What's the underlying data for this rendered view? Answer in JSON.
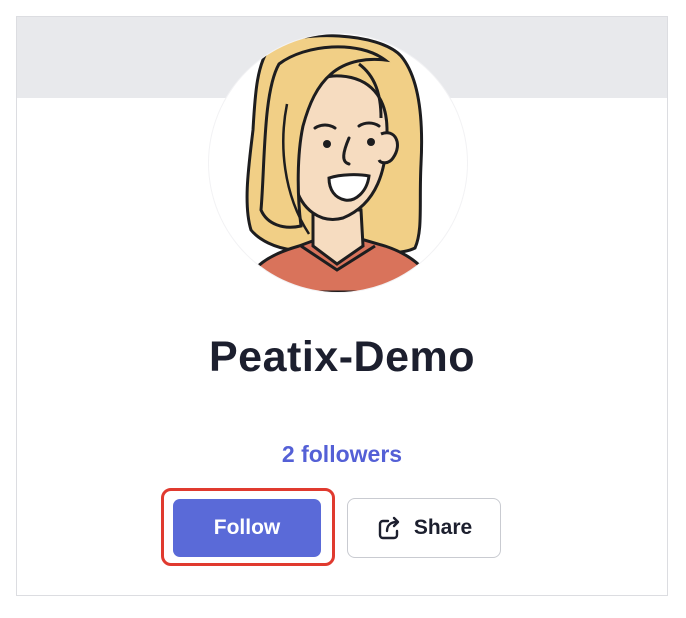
{
  "profile": {
    "name": "Peatix-Demo",
    "followers_text": "2 followers"
  },
  "actions": {
    "follow_label": "Follow",
    "share_label": "Share"
  },
  "icons": {
    "share": "share-icon",
    "avatar": "avatar-illustration"
  },
  "colors": {
    "accent": "#5a6ad8",
    "followers_link": "#5460d6",
    "highlight": "#e03a2f",
    "cover": "#e8e9ec",
    "title": "#1c1f2e"
  }
}
